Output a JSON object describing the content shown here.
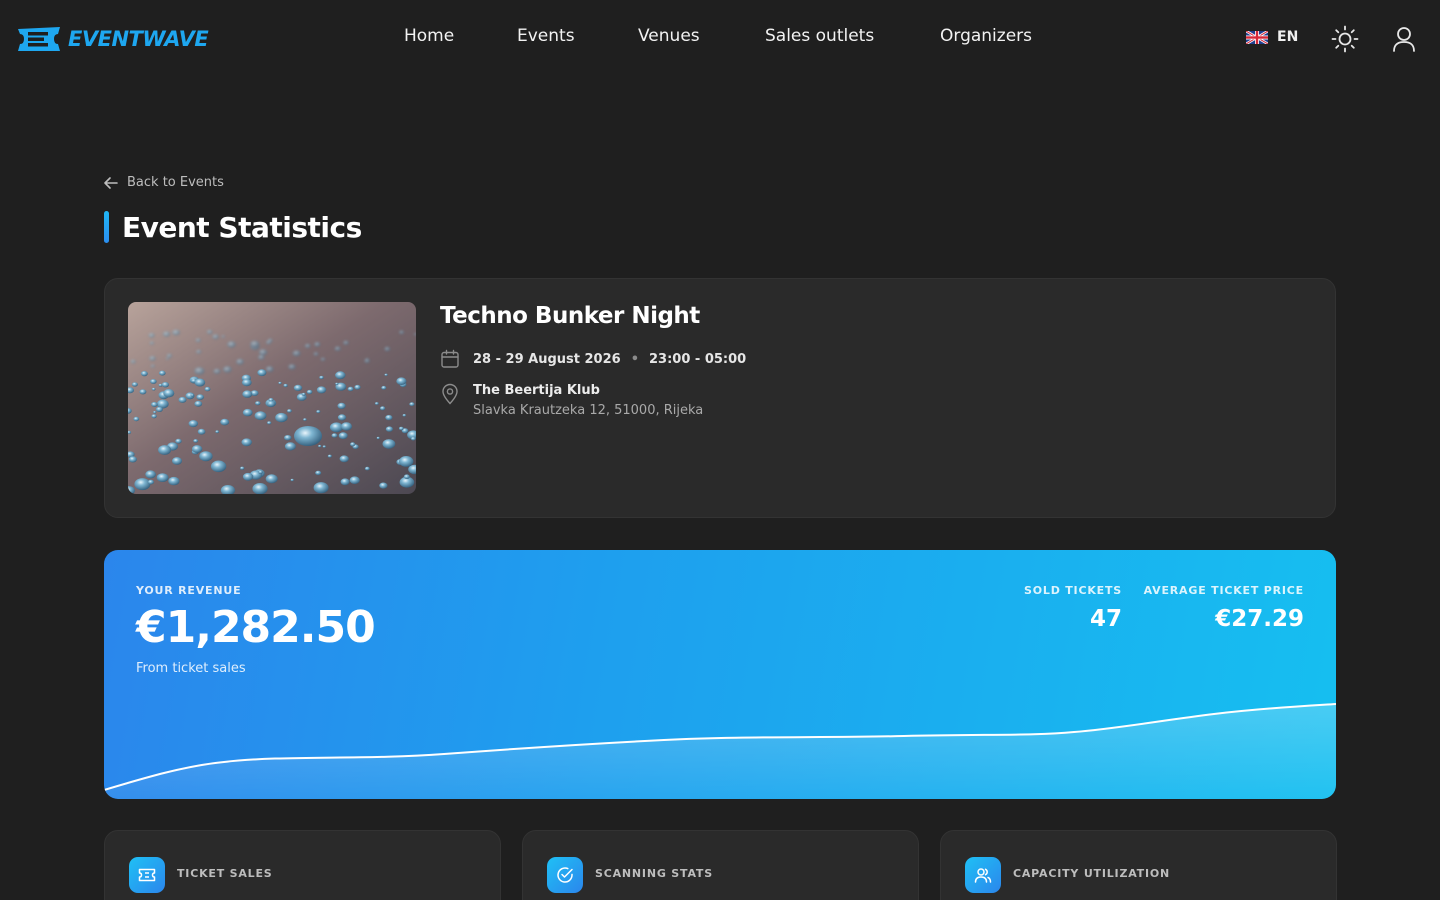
{
  "header": {
    "logo_text": "EVENTWAVE",
    "nav": [
      "Home",
      "Events",
      "Venues",
      "Sales outlets",
      "Organizers"
    ],
    "language": "EN",
    "icons": [
      "eventwave-logo-icon",
      "uk-flag-icon",
      "sun-icon",
      "user-icon"
    ]
  },
  "page": {
    "back_label": "Back to Events",
    "title": "Event Statistics"
  },
  "event": {
    "name": "Techno Bunker Night",
    "date": "28 - 29 August 2026",
    "time": "23:00 - 05:00",
    "venue": "The Beertija Klub",
    "address": "Slavka Krautzeka 12, 51000, Rijeka",
    "image_alt": "water droplets photo"
  },
  "revenue": {
    "label": "YOUR REVENUE",
    "value": "€1,282.50",
    "sub": "From ticket sales",
    "sold_label": "SOLD TICKETS",
    "sold_value": "47",
    "avg_label": "AVERAGE TICKET PRICE",
    "avg_value": "€27.29"
  },
  "cards": [
    {
      "title": "TICKET SALES",
      "icon": "ticket-icon"
    },
    {
      "title": "SCANNING STATS",
      "icon": "check-circle-icon"
    },
    {
      "title": "CAPACITY UTILIZATION",
      "icon": "users-icon"
    }
  ],
  "colors": {
    "accent": "#1ea7f0",
    "background": "#1f1f1f",
    "card": "#2a2a2a"
  }
}
